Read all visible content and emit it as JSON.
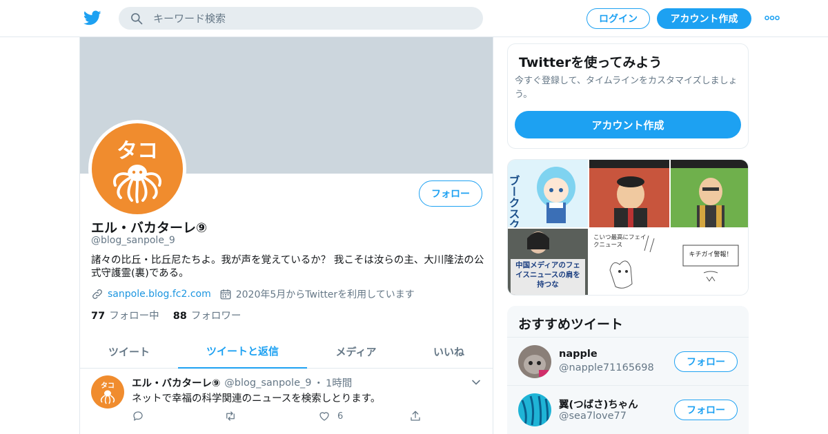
{
  "header": {
    "search_placeholder": "キーワード検索",
    "login_label": "ログイン",
    "signup_label": "アカウント作成"
  },
  "profile": {
    "follow_label": "フォロー",
    "name": "エル・バカターレ⑨",
    "handle": "@blog_sanpole_9",
    "bio": "諸々の比丘・比丘尼たちよ。我が声を覚えているか？ 我こそは汝らの主、大川隆法の公式守護霊(裏)である。",
    "link": "sanpole.blog.fc2.com",
    "joined": "2020年5月からTwitterを利用しています",
    "following_count": "77",
    "following_label": "フォロー中",
    "followers_count": "88",
    "followers_label": "フォロワー",
    "avatar_text": "タコ"
  },
  "tabs": [
    {
      "label": "ツイート"
    },
    {
      "label": "ツイートと返信"
    },
    {
      "label": "メディア"
    },
    {
      "label": "いいね"
    }
  ],
  "tweet": {
    "name": "エル・バカターレ⑨",
    "handle": "@blog_sanpole_9",
    "separator": "・",
    "time": "1時間",
    "text": "ネットで幸福の科学関連のニュースを検索しとります。",
    "like_count": "6"
  },
  "signup_card": {
    "title": "Twitterを使ってみよう",
    "description": "今すぐ登録して、タイムラインをカスタマイズしましょう。",
    "button_label": "アカウント作成"
  },
  "media": {
    "tile1_text": "ブークスクス",
    "tile4_text": "中国メディアのフェイスニュースの肩を持つな",
    "tile5_text": "こいつ最高にフェイクニュース",
    "tile6_text": "キチガイ警報！"
  },
  "recommended": {
    "title": "おすすめツイート",
    "users": [
      {
        "name": "napple",
        "handle": "@napple71165698",
        "button_label": "フォロー"
      },
      {
        "name": "翼(つばさ)ちゃん",
        "handle": "@sea7love77",
        "button_label": "フォロー"
      }
    ]
  },
  "colors": {
    "accent": "#1da1f2",
    "avatar_orange": "#f08c2e",
    "banner": "#ccd6dd"
  }
}
